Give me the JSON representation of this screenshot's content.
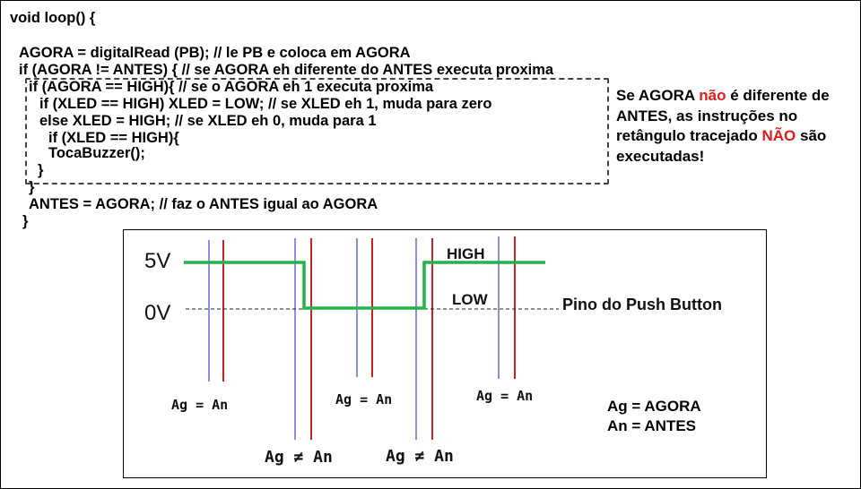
{
  "code_lines": [
    "void loop() {",
    "AGORA = digitalRead (PB); // le PB e coloca em AGORA",
    "if (AGORA != ANTES) { // se AGORA eh diferente do ANTES executa proxima",
    "if (AGORA == HIGH){ // se o AGORA eh 1 executa proxima",
    "if (XLED == HIGH) XLED = LOW; // se XLED eh 1, muda para zero",
    "else XLED = HIGH; // se XLED eh 0, muda para 1",
    "if (XLED == HIGH){",
    "TocaBuzzer();",
    "}",
    "}",
    "ANTES = AGORA; // faz o ANTES igual ao AGORA",
    "}"
  ],
  "note": {
    "part1": "Se AGORA ",
    "nao": "não",
    "part2": " é diferente de ANTES, as instruções no retângulo tracejado ",
    "NAO": "NÃO",
    "part3": " são executadas!"
  },
  "diagram": {
    "label_5v": "5V",
    "label_0v": "0V",
    "label_high": "HIGH",
    "label_low": "LOW",
    "signal_label": "Pino do Push Button",
    "eq1": "Ag = An",
    "eq2": "Ag = An",
    "eq3": "Ag = An",
    "neq1": "Ag ≠ An",
    "neq2": "Ag ≠ An",
    "legend_ag": "Ag = AGORA",
    "legend_an": "An = ANTES",
    "colors": {
      "signal": "#22b34a",
      "agora_line": "#8c8cf0",
      "antes_line": "#cc2020"
    }
  }
}
